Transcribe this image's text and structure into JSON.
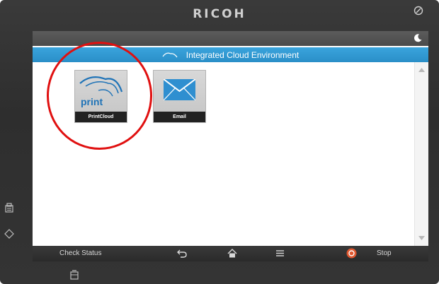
{
  "device": {
    "brand": "RICOH"
  },
  "screen": {
    "title": "Integrated Cloud Environment"
  },
  "apps": [
    {
      "label": "PrintCloud",
      "logo_text": "print",
      "icon": "print-cloud-icon"
    },
    {
      "label": "Email",
      "icon": "envelope-icon"
    }
  ],
  "bottom_bar": {
    "check_status": "Check Status",
    "stop": "Stop"
  },
  "colors": {
    "title_bar": "#2a8fc8",
    "highlight": "#e01010",
    "print_blue": "#1f73b7",
    "stop_red": "#e0572f"
  }
}
